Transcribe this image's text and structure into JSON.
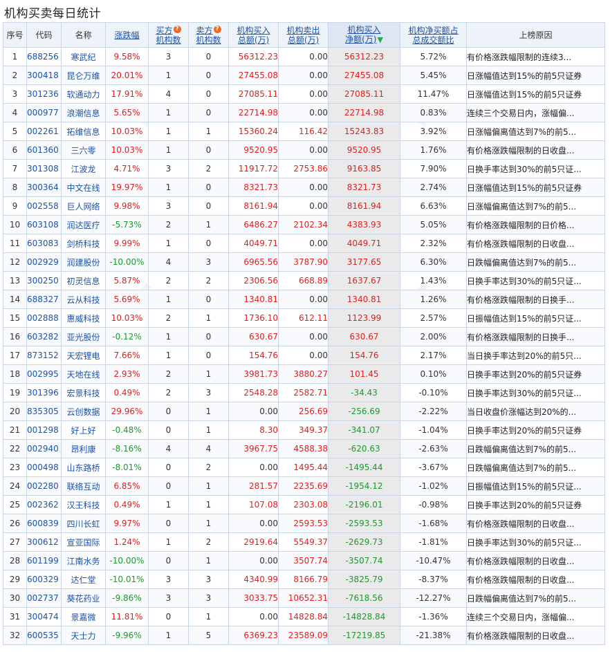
{
  "page": {
    "title": "机构买卖每日统计"
  },
  "table": {
    "headers": {
      "seq": "序号",
      "code": "代码",
      "name": "名称",
      "change": "涨跌幅",
      "buyers_1": "买方",
      "buyers_2": "机构数",
      "sellers_1": "卖方",
      "sellers_2": "机构数",
      "buy_total_1": "机构买入",
      "buy_total_2": "总额(万)",
      "sell_total_1": "机构卖出",
      "sell_total_2": "总额(万)",
      "net_buy_1": "机构买入",
      "net_buy_2": "净额(万)",
      "ratio_1": "机构净买额占",
      "ratio_2": "总成交额比",
      "reason": "上榜原因"
    },
    "rows": [
      {
        "seq": "1",
        "code": "688256",
        "name": "寒武纪",
        "change": "9.58%",
        "buyers": "3",
        "sellers": "0",
        "buy": "56312.23",
        "sell": "0.00",
        "net": "56312.23",
        "ratio": "5.72%",
        "reason": "有价格涨跌幅限制的连续3..."
      },
      {
        "seq": "2",
        "code": "300418",
        "name": "昆仑万维",
        "change": "20.01%",
        "buyers": "1",
        "sellers": "0",
        "buy": "27455.08",
        "sell": "0.00",
        "net": "27455.08",
        "ratio": "5.45%",
        "reason": "日涨幅值达到15%的前5只证券"
      },
      {
        "seq": "3",
        "code": "301236",
        "name": "软通动力",
        "change": "17.91%",
        "buyers": "4",
        "sellers": "0",
        "buy": "27085.11",
        "sell": "0.00",
        "net": "27085.11",
        "ratio": "11.47%",
        "reason": "日涨幅值达到15%的前5只证券"
      },
      {
        "seq": "4",
        "code": "000977",
        "name": "浪潮信息",
        "change": "5.65%",
        "buyers": "1",
        "sellers": "0",
        "buy": "22714.98",
        "sell": "0.00",
        "net": "22714.98",
        "ratio": "0.83%",
        "reason": "连续三个交易日内，涨幅偏..."
      },
      {
        "seq": "5",
        "code": "002261",
        "name": "拓维信息",
        "change": "10.03%",
        "buyers": "1",
        "sellers": "1",
        "buy": "15360.24",
        "sell": "116.42",
        "net": "15243.83",
        "ratio": "3.92%",
        "reason": "日涨幅偏离值达到7%的前5..."
      },
      {
        "seq": "6",
        "code": "601360",
        "name": "三六零",
        "change": "10.03%",
        "buyers": "1",
        "sellers": "0",
        "buy": "9520.95",
        "sell": "0.00",
        "net": "9520.95",
        "ratio": "1.76%",
        "reason": "有价格涨跌幅限制的日收盘..."
      },
      {
        "seq": "7",
        "code": "301308",
        "name": "江波龙",
        "change": "4.71%",
        "buyers": "3",
        "sellers": "2",
        "buy": "11917.72",
        "sell": "2753.86",
        "net": "9163.85",
        "ratio": "7.90%",
        "reason": "日换手率达到30%的前5只证..."
      },
      {
        "seq": "8",
        "code": "300364",
        "name": "中文在线",
        "change": "19.97%",
        "buyers": "1",
        "sellers": "0",
        "buy": "8321.73",
        "sell": "0.00",
        "net": "8321.73",
        "ratio": "2.74%",
        "reason": "日涨幅值达到15%的前5只证券"
      },
      {
        "seq": "9",
        "code": "002558",
        "name": "巨人网络",
        "change": "9.98%",
        "buyers": "3",
        "sellers": "0",
        "buy": "8161.94",
        "sell": "0.00",
        "net": "8161.94",
        "ratio": "6.63%",
        "reason": "日涨幅偏离值达到7%的前5..."
      },
      {
        "seq": "10",
        "code": "603108",
        "name": "润达医疗",
        "change": "-5.73%",
        "buyers": "2",
        "sellers": "1",
        "buy": "6486.27",
        "sell": "2102.34",
        "net": "4383.93",
        "ratio": "5.05%",
        "reason": "有价格涨跌幅限制的日价格..."
      },
      {
        "seq": "11",
        "code": "603083",
        "name": "剑桥科技",
        "change": "9.99%",
        "buyers": "1",
        "sellers": "0",
        "buy": "4049.71",
        "sell": "0.00",
        "net": "4049.71",
        "ratio": "2.32%",
        "reason": "有价格涨跌幅限制的日收盘..."
      },
      {
        "seq": "12",
        "code": "002929",
        "name": "润建股份",
        "change": "-10.00%",
        "buyers": "4",
        "sellers": "3",
        "buy": "6965.56",
        "sell": "3787.90",
        "net": "3177.65",
        "ratio": "6.30%",
        "reason": "日跌幅偏离值达到7%的前5..."
      },
      {
        "seq": "13",
        "code": "300250",
        "name": "初灵信息",
        "change": "5.87%",
        "buyers": "2",
        "sellers": "2",
        "buy": "2306.56",
        "sell": "668.89",
        "net": "1637.67",
        "ratio": "1.43%",
        "reason": "日换手率达到30%的前5只证..."
      },
      {
        "seq": "14",
        "code": "688327",
        "name": "云从科技",
        "change": "5.69%",
        "buyers": "1",
        "sellers": "0",
        "buy": "1340.81",
        "sell": "0.00",
        "net": "1340.81",
        "ratio": "1.26%",
        "reason": "有价格涨跌幅限制的日换手..."
      },
      {
        "seq": "15",
        "code": "002888",
        "name": "惠威科技",
        "change": "10.03%",
        "buyers": "2",
        "sellers": "1",
        "buy": "1736.10",
        "sell": "612.11",
        "net": "1123.99",
        "ratio": "2.57%",
        "reason": "日振幅值达到15%的前5只证..."
      },
      {
        "seq": "16",
        "code": "603282",
        "name": "亚光股份",
        "change": "-0.12%",
        "buyers": "1",
        "sellers": "0",
        "buy": "630.67",
        "sell": "0.00",
        "net": "630.67",
        "ratio": "2.00%",
        "reason": "有价格涨跌幅限制的日换手..."
      },
      {
        "seq": "17",
        "code": "873152",
        "name": "天宏锂电",
        "change": "7.66%",
        "buyers": "1",
        "sellers": "0",
        "buy": "154.76",
        "sell": "0.00",
        "net": "154.76",
        "ratio": "2.17%",
        "reason": "当日换手率达到20%的前5只..."
      },
      {
        "seq": "18",
        "code": "002995",
        "name": "天地在线",
        "change": "2.93%",
        "buyers": "2",
        "sellers": "1",
        "buy": "3981.73",
        "sell": "3880.27",
        "net": "101.45",
        "ratio": "0.10%",
        "reason": "日换手率达到20%的前5只证券"
      },
      {
        "seq": "19",
        "code": "301396",
        "name": "宏景科技",
        "change": "0.49%",
        "buyers": "2",
        "sellers": "3",
        "buy": "2548.28",
        "sell": "2582.71",
        "net": "-34.43",
        "ratio": "-0.10%",
        "reason": "日换手率达到30%的前5只证..."
      },
      {
        "seq": "20",
        "code": "835305",
        "name": "云创数据",
        "change": "29.96%",
        "buyers": "0",
        "sellers": "1",
        "buy": "0.00",
        "sell": "256.69",
        "net": "-256.69",
        "ratio": "-2.22%",
        "reason": "当日收盘价涨幅达到20%的..."
      },
      {
        "seq": "21",
        "code": "001298",
        "name": "好上好",
        "change": "-0.48%",
        "buyers": "0",
        "sellers": "1",
        "buy": "8.30",
        "sell": "349.37",
        "net": "-341.07",
        "ratio": "-1.04%",
        "reason": "日换手率达到20%的前5只证券"
      },
      {
        "seq": "22",
        "code": "002940",
        "name": "昂利康",
        "change": "-8.16%",
        "buyers": "4",
        "sellers": "4",
        "buy": "3967.75",
        "sell": "4588.38",
        "net": "-620.63",
        "ratio": "-2.63%",
        "reason": "日跌幅偏离值达到7%的前5..."
      },
      {
        "seq": "23",
        "code": "000498",
        "name": "山东路桥",
        "change": "-8.01%",
        "buyers": "0",
        "sellers": "2",
        "buy": "0.00",
        "sell": "1495.44",
        "net": "-1495.44",
        "ratio": "-3.67%",
        "reason": "日跌幅偏离值达到7%的前5..."
      },
      {
        "seq": "24",
        "code": "002280",
        "name": "联络互动",
        "change": "6.85%",
        "buyers": "0",
        "sellers": "1",
        "buy": "281.57",
        "sell": "2235.69",
        "net": "-1954.12",
        "ratio": "-1.02%",
        "reason": "日振幅值达到15%的前5只证..."
      },
      {
        "seq": "25",
        "code": "002362",
        "name": "汉王科技",
        "change": "0.49%",
        "buyers": "1",
        "sellers": "1",
        "buy": "107.08",
        "sell": "2303.08",
        "net": "-2196.01",
        "ratio": "-0.98%",
        "reason": "日换手率达到20%的前5只证券"
      },
      {
        "seq": "26",
        "code": "600839",
        "name": "四川长虹",
        "change": "9.97%",
        "buyers": "0",
        "sellers": "1",
        "buy": "0.00",
        "sell": "2593.53",
        "net": "-2593.53",
        "ratio": "-1.68%",
        "reason": "有价格涨跌幅限制的日收盘..."
      },
      {
        "seq": "27",
        "code": "300612",
        "name": "宣亚国际",
        "change": "1.24%",
        "buyers": "1",
        "sellers": "2",
        "buy": "2919.64",
        "sell": "5549.37",
        "net": "-2629.73",
        "ratio": "-1.81%",
        "reason": "日换手率达到30%的前5只证..."
      },
      {
        "seq": "28",
        "code": "601199",
        "name": "江南水务",
        "change": "-10.00%",
        "buyers": "0",
        "sellers": "1",
        "buy": "0.00",
        "sell": "3507.74",
        "net": "-3507.74",
        "ratio": "-10.47%",
        "reason": "有价格涨跌幅限制的日收盘..."
      },
      {
        "seq": "29",
        "code": "600329",
        "name": "达仁堂",
        "change": "-10.01%",
        "buyers": "3",
        "sellers": "3",
        "buy": "4340.99",
        "sell": "8166.79",
        "net": "-3825.79",
        "ratio": "-8.37%",
        "reason": "有价格涨跌幅限制的日收盘..."
      },
      {
        "seq": "30",
        "code": "002737",
        "name": "葵花药业",
        "change": "-9.86%",
        "buyers": "3",
        "sellers": "3",
        "buy": "3033.75",
        "sell": "10652.31",
        "net": "-7618.56",
        "ratio": "-12.27%",
        "reason": "日跌幅偏离值达到7%的前5..."
      },
      {
        "seq": "31",
        "code": "300474",
        "name": "景嘉微",
        "change": "11.81%",
        "buyers": "0",
        "sellers": "1",
        "buy": "0.00",
        "sell": "14828.84",
        "net": "-14828.84",
        "ratio": "-1.36%",
        "reason": "连续三个交易日内，涨幅偏..."
      },
      {
        "seq": "32",
        "code": "600535",
        "name": "天士力",
        "change": "-9.96%",
        "buyers": "1",
        "sellers": "5",
        "buy": "6369.23",
        "sell": "23589.09",
        "net": "-17219.85",
        "ratio": "-21.38%",
        "reason": "有价格涨跌幅限制的日收盘..."
      }
    ]
  },
  "icons": {
    "help": "help-icon",
    "sort": "sort-down-icon"
  },
  "colors": {
    "up": "#e21d1d",
    "down": "#1a9a2e",
    "link": "#1c52a8",
    "header_bg": "#eef3fa",
    "border": "#c9d6e5",
    "sorted_col_bg": "#eaeaea",
    "help_icon": "#f26a22"
  }
}
